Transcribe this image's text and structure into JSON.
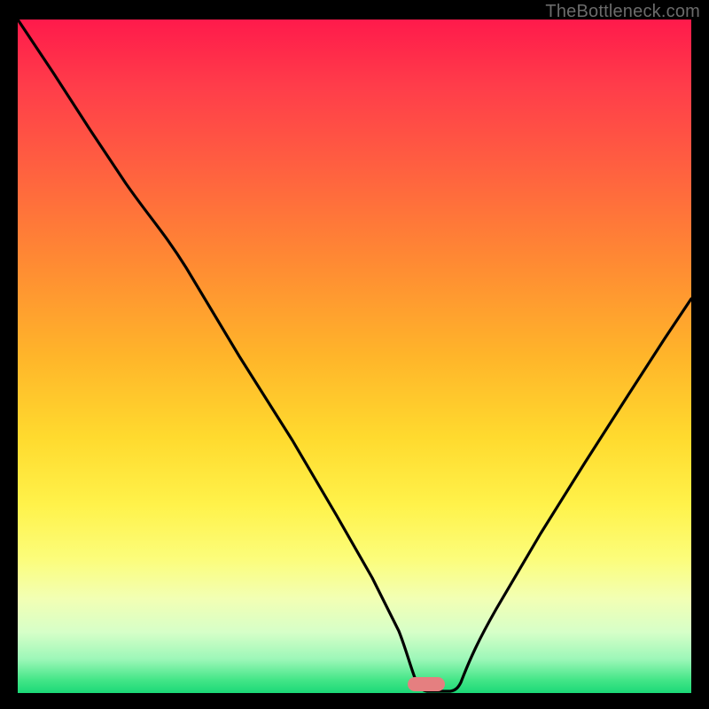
{
  "watermark": "TheBottleneck.com",
  "marker": {
    "color": "#e57f80",
    "x_frac": 0.605,
    "y_frac": 0.985
  },
  "chart_data": {
    "type": "line",
    "title": "",
    "xlabel": "",
    "ylabel": "",
    "xlim": [
      0,
      1
    ],
    "ylim": [
      0,
      1
    ],
    "x": [
      0.0,
      0.05,
      0.1,
      0.15,
      0.2,
      0.25,
      0.3,
      0.35,
      0.4,
      0.45,
      0.5,
      0.55,
      0.58,
      0.6,
      0.62,
      0.65,
      0.7,
      0.75,
      0.8,
      0.85,
      0.9,
      0.95,
      1.0
    ],
    "values": [
      1.0,
      0.92,
      0.84,
      0.76,
      0.7,
      0.61,
      0.51,
      0.41,
      0.31,
      0.22,
      0.13,
      0.05,
      0.01,
      0.0,
      0.0,
      0.02,
      0.09,
      0.17,
      0.25,
      0.33,
      0.41,
      0.48,
      0.55
    ],
    "background_gradient": {
      "top": "#ff1a4b",
      "mid_upper": "#ff8a33",
      "mid": "#ffda2e",
      "mid_lower": "#f2ffb4",
      "bottom": "#1bd877"
    },
    "curve_color": "#000000",
    "marker_position_x": 0.605
  }
}
